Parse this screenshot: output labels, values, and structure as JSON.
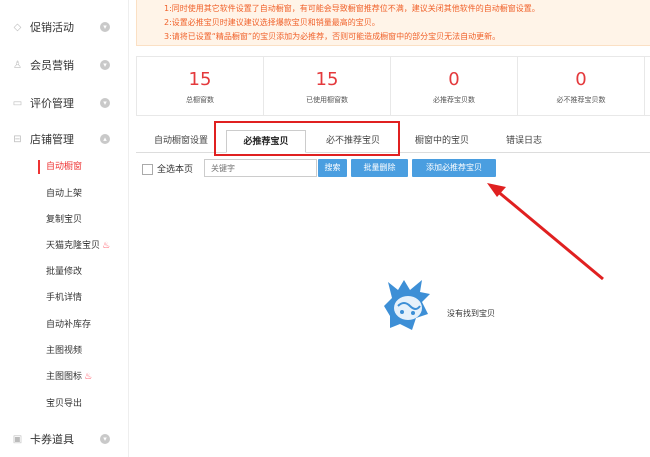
{
  "sidebar": {
    "groups": [
      {
        "label": "促销活动",
        "icon": "tag-icon"
      },
      {
        "label": "会员营销",
        "icon": "user-icon"
      },
      {
        "label": "评价管理",
        "icon": "comment-icon"
      },
      {
        "label": "店铺管理",
        "icon": "store-icon"
      },
      {
        "label": "卡券道具",
        "icon": "card-icon"
      }
    ],
    "store_items": [
      {
        "label": "自动橱窗",
        "active": true
      },
      {
        "label": "自动上架"
      },
      {
        "label": "复制宝贝"
      },
      {
        "label": "天猫克隆宝贝",
        "fire": true
      },
      {
        "label": "批量修改"
      },
      {
        "label": "手机详情"
      },
      {
        "label": "自动补库存"
      },
      {
        "label": "主图视频"
      },
      {
        "label": "主图图标",
        "fire": true
      },
      {
        "label": "宝贝导出"
      }
    ]
  },
  "notice": {
    "line1": "1:同时使用其它软件设置了自动橱窗，有可能会导致橱窗推荐位不满，建议关闭其他软件的自动橱窗设置。",
    "line2": "2:设置必推宝贝时建议建议选择爆款宝贝和销量最高的宝贝。",
    "line3": "3:请将已设置“精品橱窗”的宝贝添加为必推荐，否则可能造成橱窗中的部分宝贝无法自动更新。"
  },
  "stats": [
    {
      "value": "15",
      "label": "总橱窗数"
    },
    {
      "value": "15",
      "label": "已使用橱窗数"
    },
    {
      "value": "0",
      "label": "必推荐宝贝数"
    },
    {
      "value": "0",
      "label": "必不推荐宝贝数"
    }
  ],
  "tabs": [
    {
      "label": "自动橱窗设置"
    },
    {
      "label": "必推荐宝贝",
      "active": true
    },
    {
      "label": "必不推荐宝贝"
    },
    {
      "label": "橱窗中的宝贝"
    },
    {
      "label": "错误日志"
    }
  ],
  "toolbar": {
    "select_all_label": "全选本页",
    "search_placeholder": "关键字",
    "search_button": "搜索",
    "bulk_delete_button": "批量删除",
    "add_button": "添加必推荐宝贝"
  },
  "empty_state": {
    "text": "没有找到宝贝"
  },
  "colors": {
    "accent_red": "#e4393c",
    "button_blue": "#4a9ee0",
    "annotation_red": "#e02020",
    "notice_text": "#f0622b"
  }
}
